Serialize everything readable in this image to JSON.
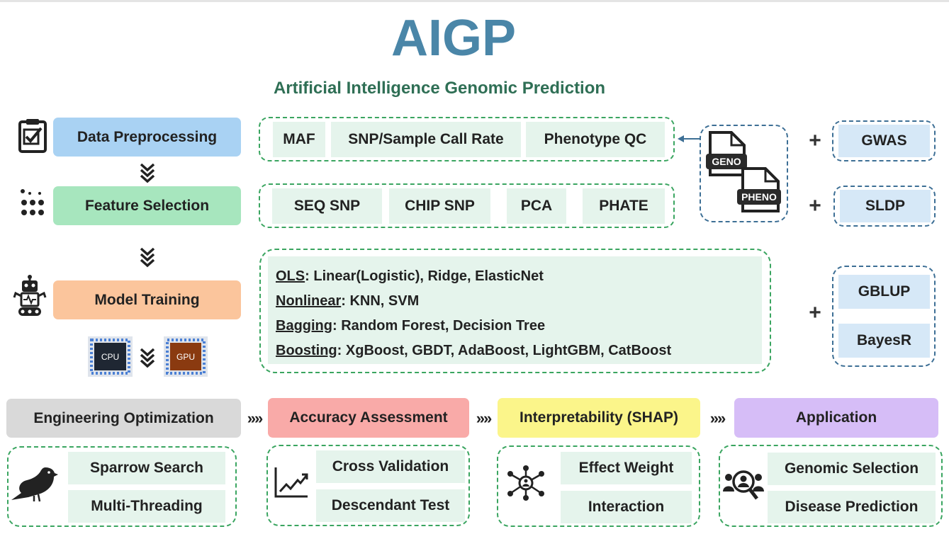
{
  "title": "AIGP",
  "subtitle": "Artificial Intelligence Genomic Prediction",
  "pipeline": {
    "data_preprocessing": "Data Preprocessing",
    "feature_selection": "Feature Selection",
    "model_training": "Model Training",
    "cpu": "CPU",
    "gpu": "GPU"
  },
  "preprocessing_items": [
    "MAF",
    "SNP/Sample Call Rate",
    "Phenotype QC"
  ],
  "feature_items": [
    "SEQ SNP",
    "CHIP SNP",
    "PCA",
    "PHATE"
  ],
  "models": [
    {
      "category": "OLS",
      "sep": ":",
      "methods": " Linear(Logistic), Ridge, ElasticNet"
    },
    {
      "category": "Nonlinear",
      "sep": ":",
      "methods": " KNN, SVM"
    },
    {
      "category": "Bagging",
      "sep": ":",
      "methods": " Random Forest, Decision Tree"
    },
    {
      "category": "Boosting",
      "sep": ":",
      "methods": " XgBoost, GBDT, AdaBoost, LightGBM, CatBoost"
    }
  ],
  "input_files": {
    "geno": "GENO",
    "pheno": "PHENO"
  },
  "extras": {
    "plus": "+",
    "gwas": "GWAS",
    "sldp": "SLDP",
    "gblup": "GBLUP",
    "bayesr": "BayesR"
  },
  "bottom_steps": {
    "engineering": "Engineering Optimization",
    "accuracy": "Accuracy Assessment",
    "interpretability": "Interpretability (SHAP)",
    "application": "Application",
    "arrow": "»»"
  },
  "engineering_items": [
    "Sparrow Search",
    "Multi-Threading"
  ],
  "accuracy_items": [
    "Cross Validation",
    "Descendant Test"
  ],
  "interpretability_items": [
    "Effect Weight",
    "Interaction"
  ],
  "application_items": [
    "Genomic Selection",
    "Disease Prediction"
  ],
  "colors": {
    "title": "#4a86a8",
    "subtitle": "#2f6f55",
    "data_preprocessing": "#a9d2f3",
    "feature_selection": "#a7e6be",
    "model_training": "#fbc59c",
    "engineering": "#d9d9d9",
    "accuracy": "#f9aaa8",
    "interpretability": "#fbf58a",
    "application": "#d6bdf7"
  }
}
